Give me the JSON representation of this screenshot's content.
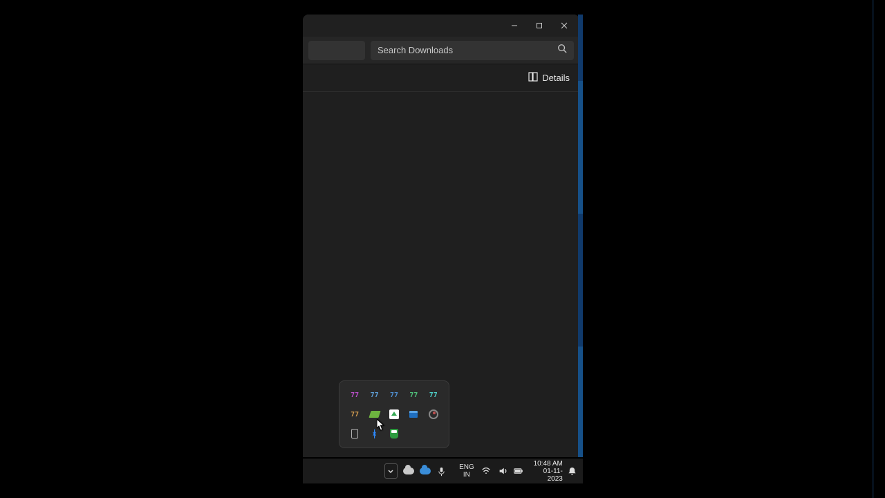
{
  "window": {
    "search_placeholder": "Search Downloads",
    "view_toggle": "Details"
  },
  "tray_flyout": {
    "items": [
      {
        "label": "77",
        "color": "c-purple"
      },
      {
        "label": "77",
        "color": "c-blue1"
      },
      {
        "label": "77",
        "color": "c-blue2"
      },
      {
        "label": "77",
        "color": "c-green"
      },
      {
        "label": "77",
        "color": "c-cyan"
      },
      {
        "label": "77",
        "color": "c-orange"
      }
    ]
  },
  "taskbar": {
    "lang_top": "ENG",
    "lang_bottom": "IN",
    "time": "10:48 AM",
    "date": "01-11-2023"
  }
}
